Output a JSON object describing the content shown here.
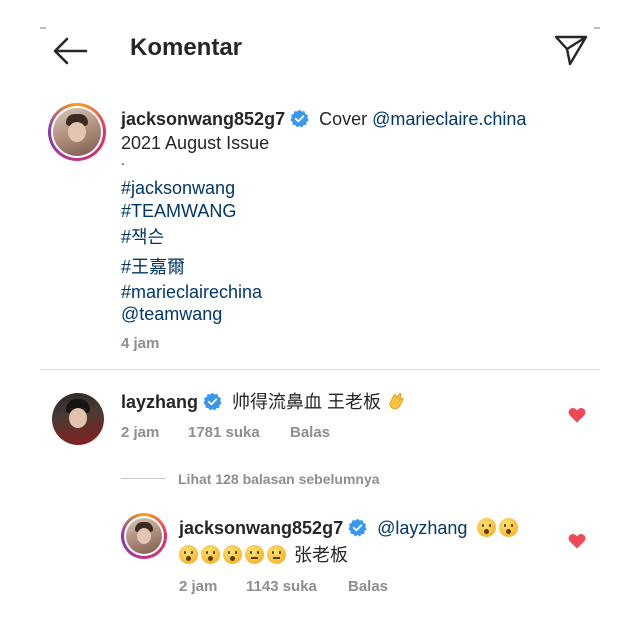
{
  "header": {
    "title": "Komentar",
    "back_icon": "arrow-left-icon",
    "send_icon": "send-icon"
  },
  "post": {
    "username": "jacksonwang852g7",
    "caption_text": "Cover ",
    "caption_mention": "@marieclaire.china",
    "caption_line2": "2021 August Issue",
    "dot": ".",
    "tags": [
      "#jacksonwang",
      "#TEAMWANG",
      "#잭슨",
      "#王嘉爾",
      "#marieclairechina",
      "@teamwang"
    ],
    "time": "4 jam"
  },
  "comment": {
    "username": "layzhang",
    "text": "帅得流鼻血 王老板",
    "emoji": "clapping-hands-icon",
    "time": "2 jam",
    "likes": "1781 suka",
    "reply_label": "Balas"
  },
  "view_replies": "Lihat 128 balasan sebelumnya",
  "reply": {
    "username": "jacksonwang852g7",
    "mention": "@layzhang",
    "text_tail": "张老板",
    "time": "2 jam",
    "likes": "1143 suka",
    "reply_label": "Balas"
  },
  "colors": {
    "link": "#00376b",
    "verified": "#3897f0",
    "heart": "#ed4956",
    "meta": "#8e8e8e"
  }
}
